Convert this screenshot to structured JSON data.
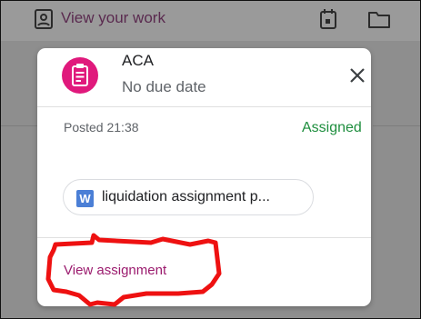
{
  "background": {
    "header_link": "View your work",
    "icons": [
      "assignment-person-icon",
      "calendar-icon",
      "folder-icon"
    ]
  },
  "dialog": {
    "title": "ACA",
    "due": "No due date",
    "posted": "Posted 21:38",
    "status": "Assigned",
    "attachment": {
      "type_letter": "W",
      "name": "liquidation assignment p..."
    },
    "view_link": "View assignment",
    "colors": {
      "badge": "#e0197c",
      "status": "#1e8e3e",
      "link": "#9b1b6e",
      "annotation": "#ee1111"
    }
  }
}
